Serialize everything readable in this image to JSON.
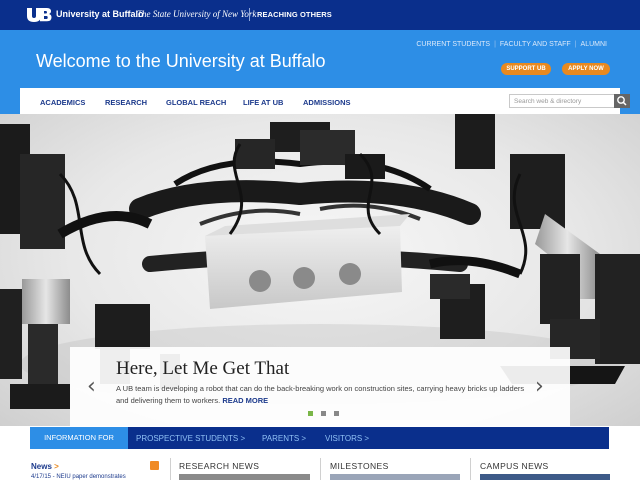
{
  "header": {
    "logo_icon": "ub-logo-icon",
    "name": "University at Buffalo",
    "suny": "The State University of New York",
    "tagline": "REACHING OTHERS"
  },
  "banner": {
    "welcome": "Welcome to the University at Buffalo",
    "utility_links": [
      "CURRENT STUDENTS",
      "FACULTY AND STAFF",
      "ALUMNI"
    ],
    "support_button": "SUPPORT UB",
    "apply_button": "APPLY NOW"
  },
  "nav": {
    "items": [
      "ACADEMICS",
      "RESEARCH",
      "GLOBAL REACH",
      "LIFE AT UB",
      "ADMISSIONS"
    ],
    "search_placeholder": "Search web & directory",
    "search_icon": "search-icon"
  },
  "hero": {
    "title": "Here, Let Me Get That",
    "text": "A UB team is developing a robot that can do the back-breaking work on construction sites, carrying heavy bricks up ladders and delivering them to workers.",
    "read_more": "READ MORE",
    "prev_icon": "chevron-left-icon",
    "next_icon": "chevron-right-icon",
    "slides": 3,
    "active_slide": 1
  },
  "info_bar": {
    "label": "INFORMATION FOR",
    "links": [
      "PROSPECTIVE STUDENTS >",
      "PARENTS >",
      "VISITORS >"
    ]
  },
  "sections": {
    "news": "News",
    "news_arrow": ">",
    "news_item": "4/17/15 - NEIU paper demonstrates",
    "rss_icon": "rss-icon",
    "research_news": "RESEARCH NEWS",
    "milestones": "MILESTONES",
    "campus_news": "CAMPUS NEWS"
  },
  "colors": {
    "navy": "#0a2f8c",
    "blue": "#2d8ee6",
    "orange": "#e8891f",
    "green": "#7ab648"
  }
}
